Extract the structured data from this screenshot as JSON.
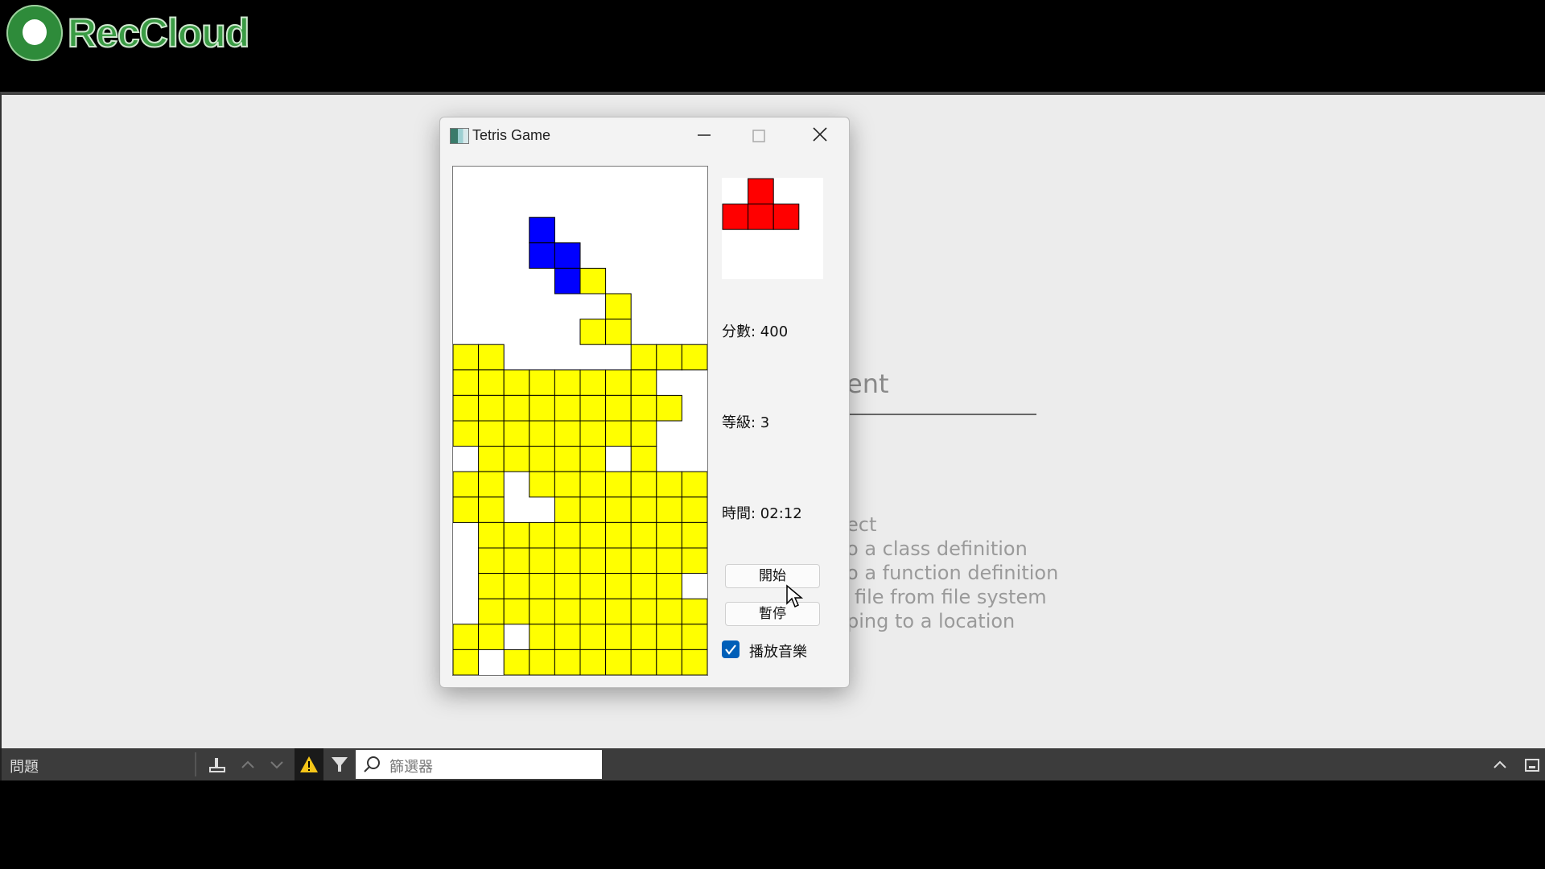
{
  "recorder": {
    "brand": "RecCloud"
  },
  "ide_background": {
    "heading_fragment": "ent",
    "lines": [
      "ect",
      "o a class definition",
      "o a function definition",
      "file from file system",
      "ping to a location"
    ]
  },
  "panel": {
    "title": "問題",
    "filter_placeholder": "篩選器"
  },
  "window": {
    "title": "Tetris Game",
    "score_label": "分數: 400",
    "level_label": "等級: 3",
    "time_label": "時間: 02:12",
    "start_button": "開始",
    "pause_button": "暫停",
    "music_label": "播放音樂",
    "music_checked": true
  },
  "game": {
    "cols": 10,
    "rows": 20,
    "colors": {
      "Y": "#ffff00",
      "B": "#0000ff",
      "R": "#ff0000",
      "cell_border": "#000000"
    },
    "board": [
      "..........",
      "..........",
      "...B......",
      "...BB.....",
      "....BY....",
      "......Y...",
      ".....YY...",
      "YY.....YYY",
      "YYYYYYYY..",
      "YYYYYYYYY.",
      "YYYYYYYY..",
      ".YYYYY.Y..",
      "YY.YYYYYYY",
      "YY..YYYYYY",
      ".YYYYYYYYY",
      ".YYYYYYYYY",
      ".YYYYYYYY.",
      ".YYYYYYYYY",
      "YY.YYYYYYY",
      "Y.YYYYYYYY"
    ],
    "next_piece": {
      "color": "R",
      "cells": [
        [
          1,
          0
        ],
        [
          0,
          1
        ],
        [
          1,
          1
        ],
        [
          2,
          1
        ]
      ]
    }
  }
}
